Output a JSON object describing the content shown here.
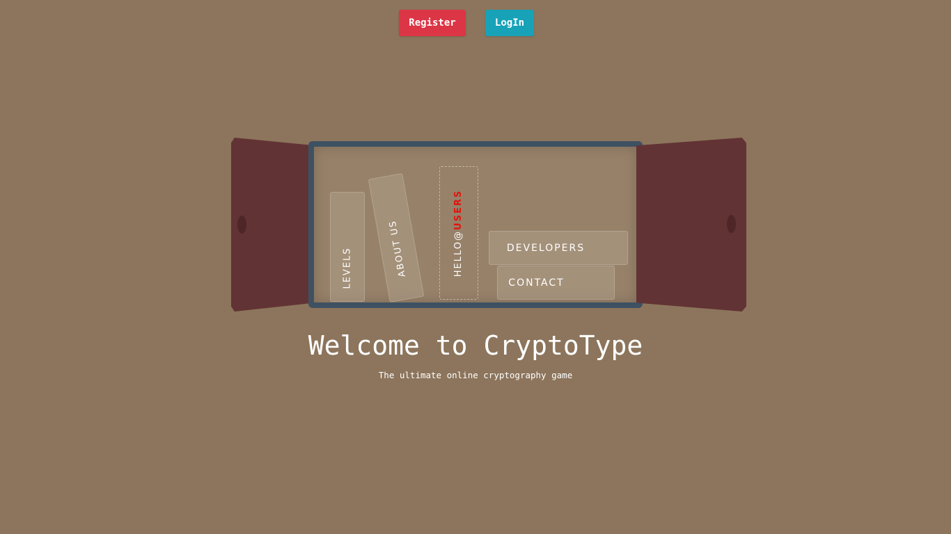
{
  "header": {
    "register_label": "Register",
    "login_label": "LogIn"
  },
  "shelf": {
    "books": {
      "levels": "LEVELS",
      "about": "ABOUT US",
      "hello_prefix": "HELLO@",
      "hello_suffix": "USERS",
      "developers": "DEVELOPERS",
      "contact": "CONTACT"
    }
  },
  "hero": {
    "title": "Welcome to CryptoType",
    "subtitle": "The ultimate online cryptography game"
  },
  "colors": {
    "background": "#8c755c",
    "door": "#623334",
    "shelf_frame": "#3e5163",
    "register": "#dc3545",
    "login": "#17a2b8",
    "highlight": "#e0140e"
  }
}
